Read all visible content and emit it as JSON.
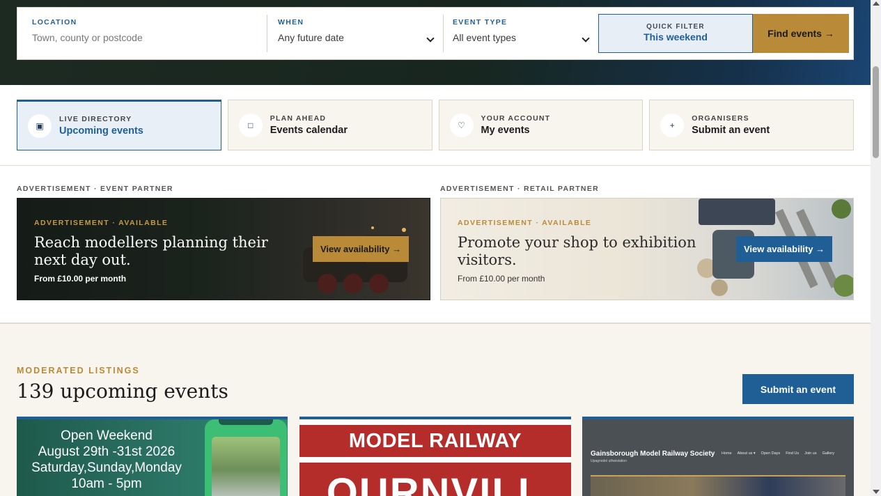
{
  "search": {
    "location_label": "LOCATION",
    "location_placeholder": "Town, county or postcode",
    "when_label": "WHEN",
    "when_value": "Any future date",
    "type_label": "EVENT TYPE",
    "type_value": "All event types",
    "quick_filter_label": "QUICK FILTER",
    "quick_filter_value": "This weekend",
    "find_button": "Find events →"
  },
  "nav": {
    "items": [
      {
        "label": "LIVE DIRECTORY",
        "title": "Upcoming events",
        "icon": "▣",
        "active": true
      },
      {
        "label": "PLAN AHEAD",
        "title": "Events calendar",
        "icon": "□"
      },
      {
        "label": "YOUR ACCOUNT",
        "title": "My events",
        "icon": "♡"
      },
      {
        "label": "ORGANISERS",
        "title": "Submit an event",
        "icon": "+"
      }
    ]
  },
  "ads": {
    "left_header": "ADVERTISEMENT · EVENT PARTNER",
    "right_header": "ADVERTISEMENT · RETAIL PARTNER",
    "left": {
      "tag": "ADVERTISEMENT · AVAILABLE",
      "headline": "Reach modellers planning their next day out.",
      "price": "From £10.00 per month",
      "button": "View availability →"
    },
    "right": {
      "tag": "ADVERTISEMENT · AVAILABLE",
      "headline": "Promote your shop to exhibition visitors.",
      "price": "From £10.00 per month",
      "button": "View availability →"
    }
  },
  "listings": {
    "eyebrow": "MODERATED LISTINGS",
    "count_title": "139 upcoming events",
    "submit_button": "Submit an event",
    "cards": [
      {
        "lines": [
          "Open Weekend",
          "August 29th -31st 2026",
          "Saturday,Sunday,Monday",
          "10am - 5pm"
        ]
      },
      {
        "top": "MODEL RAILWAY",
        "bottom": "OURNVILL"
      },
      {
        "site": "Gainsborough Model Railway Society",
        "sub": "Upagnodel uthwistation",
        "menu": [
          "Home",
          "About us ▾",
          "Open Days",
          "Find Us",
          "Join us",
          "Gallery"
        ]
      }
    ]
  },
  "colors": {
    "accent_blue": "#1f5f96",
    "accent_gold": "#b98a38",
    "cream": "#f8f5ef"
  }
}
